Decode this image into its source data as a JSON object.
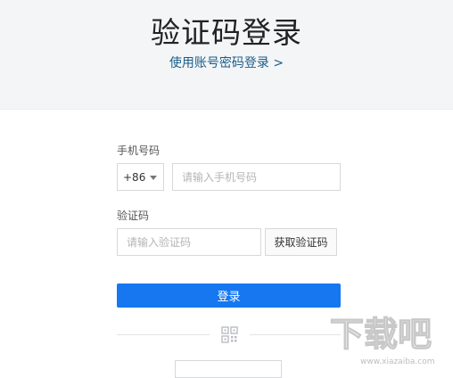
{
  "header": {
    "title": "验证码登录",
    "switch_link": "使用账号密码登录 >"
  },
  "form": {
    "phone_label": "手机号码",
    "country_code": "+86",
    "phone_placeholder": "请输入手机号码",
    "code_label": "验证码",
    "code_placeholder": "请输入验证码",
    "get_code_label": "获取验证码",
    "login_label": "登录"
  },
  "footer": {
    "qr_icon": "qr-code-icon"
  },
  "watermark": {
    "logo_text": "下载吧",
    "url": "www.xiazaiba.com"
  },
  "colors": {
    "header_bg": "#f4f5f7",
    "link": "#1a5e8a",
    "primary_button": "#1677f1"
  }
}
